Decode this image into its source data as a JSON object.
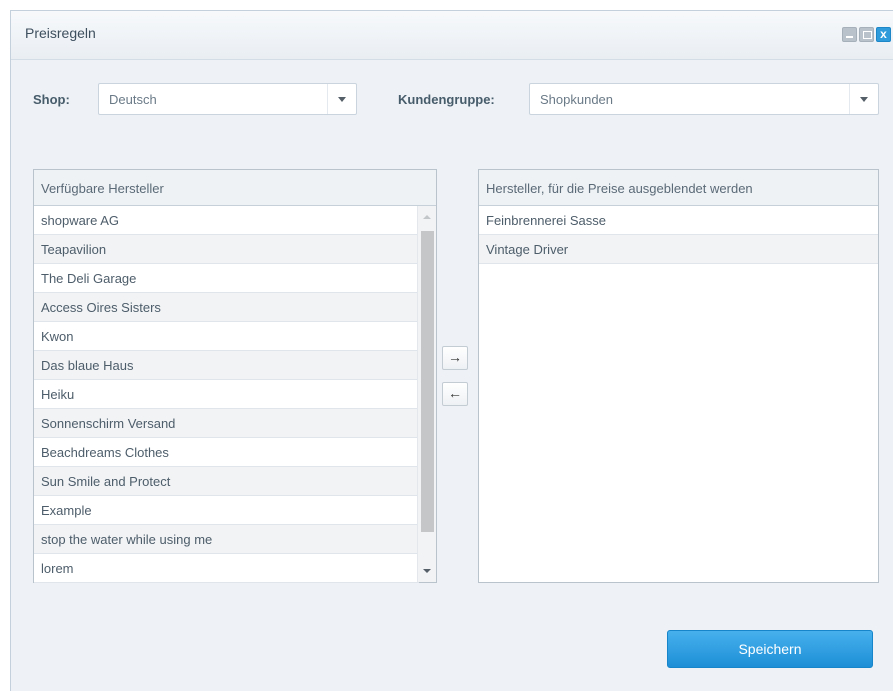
{
  "window": {
    "title": "Preisregeln",
    "controls": {
      "minimize_icon": "minimize-icon",
      "maximize_icon": "maximize-icon",
      "close_icon": "close-icon",
      "close_glyph": "x"
    }
  },
  "filters": {
    "shop_label": "Shop:",
    "shop_value": "Deutsch",
    "customer_group_label": "Kundengruppe:",
    "customer_group_value": "Shopkunden"
  },
  "available": {
    "header": "Verfügbare Hersteller",
    "items": [
      "shopware AG",
      "Teapavilion",
      "The Deli Garage",
      "Access Oires Sisters",
      "Kwon",
      "Das blaue Haus",
      "Heiku",
      "Sonnenschirm Versand",
      "Beachdreams Clothes",
      "Sun Smile and Protect",
      "Example",
      "stop the water while using me",
      "lorem"
    ]
  },
  "hidden": {
    "header": "Hersteller, für die Preise ausgeblendet werden",
    "items": [
      "Feinbrennerei Sasse",
      "Vintage Driver"
    ]
  },
  "move_buttons": {
    "right_glyph": "→",
    "left_glyph": "←"
  },
  "save_button": "Speichern",
  "colors": {
    "accent": "#2f9bda",
    "window_bg": "#eef2f6"
  }
}
